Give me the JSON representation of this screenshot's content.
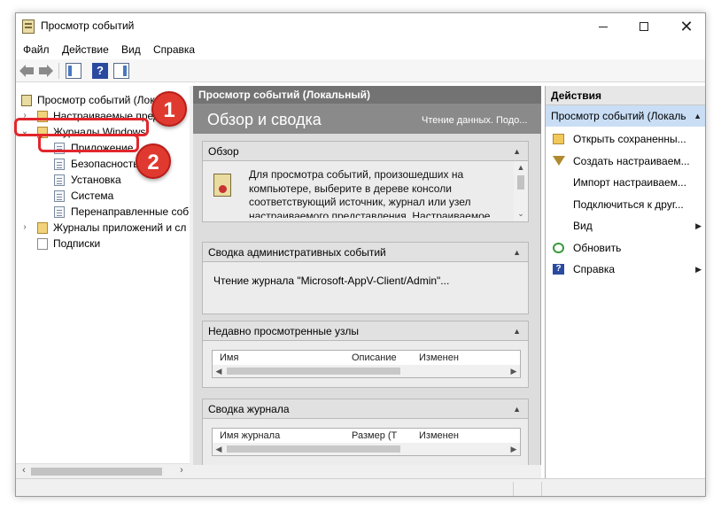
{
  "window": {
    "title": "Просмотр событий"
  },
  "menu": [
    "Файл",
    "Действие",
    "Вид",
    "Справка"
  ],
  "toolbar": {
    "icons": [
      "back-arrow-icon",
      "forward-arrow-icon",
      "console-tree-icon",
      "help-icon",
      "action-pane-icon"
    ],
    "help_glyph": "?"
  },
  "tree": {
    "items": [
      {
        "label": "Просмотр событий (Локаль",
        "level": 0,
        "expander": ""
      },
      {
        "label": "Настраиваемые предс",
        "level": 1,
        "expander": "›"
      },
      {
        "label": "Журналы Windows",
        "level": 1,
        "expander": "⌄"
      },
      {
        "label": "Приложение",
        "level": 2,
        "expander": ""
      },
      {
        "label": "Безопасность",
        "level": 2,
        "expander": ""
      },
      {
        "label": "Установка",
        "level": 2,
        "expander": ""
      },
      {
        "label": "Система",
        "level": 2,
        "expander": ""
      },
      {
        "label": "Перенаправленные соб",
        "level": 2,
        "expander": ""
      },
      {
        "label": "Журналы приложений и сл",
        "level": 1,
        "expander": "›"
      },
      {
        "label": "Подписки",
        "level": 1,
        "expander": ""
      }
    ]
  },
  "center": {
    "header": "Просмотр событий (Локальный)",
    "banner_title": "Обзор и сводка",
    "banner_status": "Чтение данных. Подо...",
    "overview": {
      "title": "Обзор",
      "text": "Для просмотра событий, произошедших на компьютере, выберите в дереве консоли соответствующий источник, журнал или узел настраиваемого представления. Настраиваемое"
    },
    "admin_summary": {
      "title": "Сводка административных событий",
      "text": "Чтение журнала \"Microsoft-AppV-Client/Admin\"..."
    },
    "recent_nodes": {
      "title": "Недавно просмотренные узлы",
      "columns": [
        "Имя",
        "Описание",
        "Изменен"
      ]
    },
    "log_summary": {
      "title": "Сводка журнала",
      "columns": [
        "Имя журнала",
        "Размер (Т",
        "Изменен"
      ]
    }
  },
  "actions": {
    "header": "Действия",
    "group": "Просмотр событий (Локаль",
    "items": [
      {
        "label": "Открыть сохраненны...",
        "icon": "open-folder-icon",
        "submenu": false
      },
      {
        "label": "Создать настраиваем...",
        "icon": "filter-icon",
        "submenu": false
      },
      {
        "label": "Импорт настраиваем...",
        "icon": "",
        "submenu": false
      },
      {
        "label": "Подключиться к друг...",
        "icon": "",
        "submenu": false
      },
      {
        "label": "Вид",
        "icon": "",
        "submenu": true
      },
      {
        "label": "Обновить",
        "icon": "refresh-icon",
        "submenu": false
      },
      {
        "label": "Справка",
        "icon": "help-icon",
        "submenu": true
      }
    ]
  },
  "annotations": {
    "badge1": "1",
    "badge2": "2",
    "highlight_color": "#e2262c"
  }
}
